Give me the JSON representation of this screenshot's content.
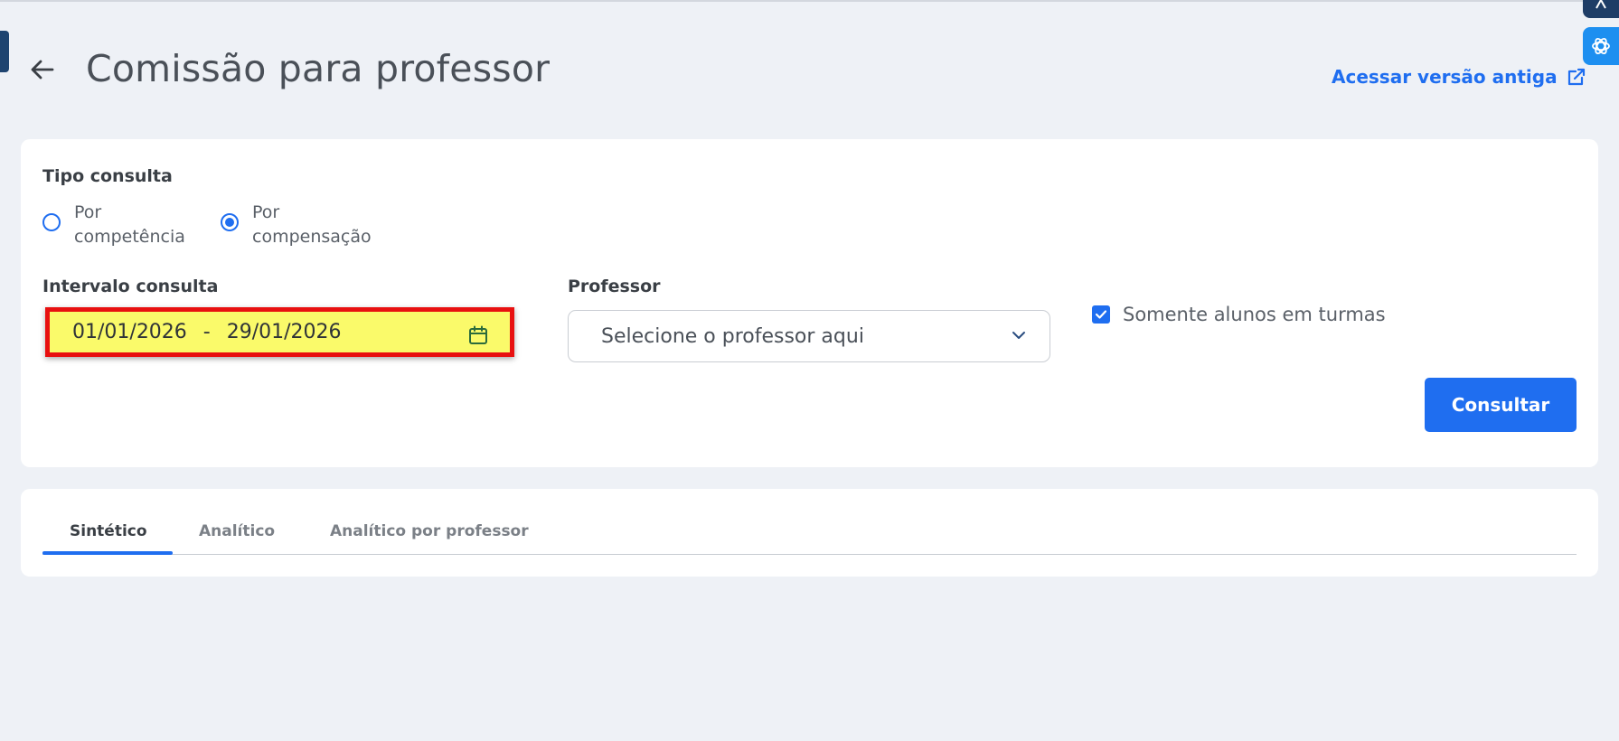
{
  "header": {
    "title": "Comissão para professor",
    "old_version_link": "Acessar versão antiga"
  },
  "filters": {
    "query_type": {
      "label": "Tipo consulta",
      "options": [
        {
          "line1": "Por",
          "line2": "competência",
          "selected": false
        },
        {
          "line1": "Por",
          "line2": "compensação",
          "selected": true
        }
      ]
    },
    "interval": {
      "label": "Intervalo consulta",
      "value": "01/01/2026  -  29/01/2026"
    },
    "professor": {
      "label": "Professor",
      "placeholder": "Selecione o professor aqui"
    },
    "only_class_students": {
      "label": "Somente alunos em turmas",
      "checked": true
    },
    "submit_label": "Consultar"
  },
  "tabs": [
    {
      "label": "Sintético",
      "active": true
    },
    {
      "label": "Analítico",
      "active": false
    },
    {
      "label": "Analítico por professor",
      "active": false
    }
  ],
  "colors": {
    "accent": "#1f6ef0",
    "highlight_fill": "#fafa6a",
    "highlight_border": "#e81010",
    "background": "#eef1f6"
  }
}
